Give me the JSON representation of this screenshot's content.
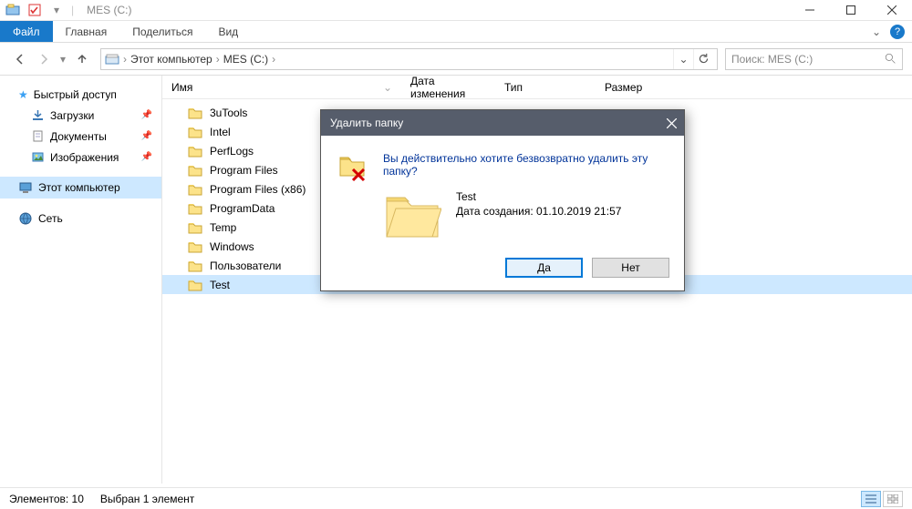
{
  "window": {
    "title": "MES (C:)"
  },
  "ribbon": {
    "file": "Файл",
    "tabs": [
      "Главная",
      "Поделиться",
      "Вид"
    ]
  },
  "breadcrumb": {
    "items": [
      "Этот компьютер",
      "MES (C:)"
    ]
  },
  "search": {
    "placeholder": "Поиск: MES (C:)"
  },
  "sidebar": {
    "quick": "Быстрый доступ",
    "items": [
      {
        "label": "Загрузки",
        "pin": true
      },
      {
        "label": "Документы",
        "pin": true
      },
      {
        "label": "Изображения",
        "pin": true
      }
    ],
    "thispc": "Этот компьютер",
    "network": "Сеть"
  },
  "columns": {
    "name": "Имя",
    "date": "Дата изменения",
    "type": "Тип",
    "size": "Размер"
  },
  "files": [
    "3uTools",
    "Intel",
    "PerfLogs",
    "Program Files",
    "Program Files (x86)",
    "ProgramData",
    "Temp",
    "Windows",
    "Пользователи",
    "Test"
  ],
  "selected_file_index": 9,
  "status": {
    "count": "Элементов: 10",
    "selection": "Выбран 1 элемент"
  },
  "dialog": {
    "title": "Удалить папку",
    "question": "Вы действительно хотите безвозвратно удалить эту папку?",
    "item_name": "Test",
    "item_meta": "Дата создания: 01.10.2019 21:57",
    "yes": "Да",
    "no": "Нет"
  }
}
